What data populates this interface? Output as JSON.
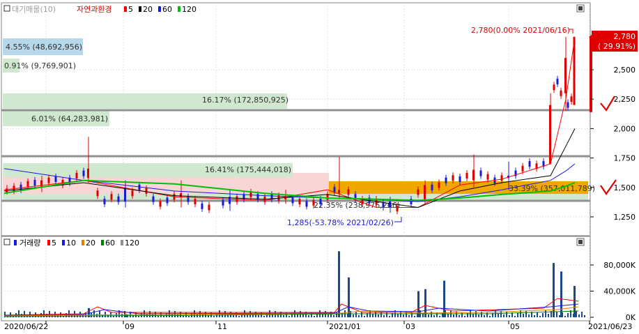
{
  "price_panel": {
    "legend": {
      "prefix_label": "대기매물(10)",
      "title": "자연과환경",
      "ma_items": [
        {
          "label": "5",
          "color": "#ff0000"
        },
        {
          "label": "20",
          "color": "#000000"
        },
        {
          "label": "60",
          "color": "#1a1adb"
        },
        {
          "label": "120",
          "color": "#00c000"
        }
      ]
    },
    "y_ticks": [
      "2,500",
      "2,250",
      "2,000",
      "1,750",
      "1,500",
      "1,250"
    ],
    "current_price": {
      "price": "2,780",
      "change": "( 29.91%)"
    },
    "high_annotation": "2,780(0.00% 2021/06/16)",
    "low_annotation": "1,285(-53.78% 2021/02/26)",
    "supply_zones": [
      {
        "label": "4.55% (48,692,956)",
        "pct": 4.55
      },
      {
        "label": "0.91% (9,769,901)",
        "pct": 0.91
      },
      {
        "label": "16.17% (172,850,925)",
        "pct": 16.17
      },
      {
        "label": "6.01% (64,283,981)",
        "pct": 6.01
      },
      {
        "label": "16.41% (175,444,018)",
        "pct": 16.41
      },
      {
        "label": "33.39% (357,011,789)",
        "pct": 33.39
      },
      {
        "label": "22.35% (238,976,266)",
        "pct": 22.35
      }
    ]
  },
  "volume_panel": {
    "legend": {
      "title": "거래량",
      "ma_items": [
        {
          "label": "5",
          "color": "#ff0000"
        },
        {
          "label": "10",
          "color": "#1a1adb"
        },
        {
          "label": "20",
          "color": "#e08000"
        },
        {
          "label": "60",
          "color": "#008000"
        },
        {
          "label": "120",
          "color": "#909090"
        }
      ]
    },
    "y_ticks": [
      "80,000K",
      "40,000K",
      "0K"
    ]
  },
  "x_axis_labels": [
    "2020/06/22",
    "09",
    "11",
    "2021/01",
    "03",
    "05",
    "2021/06/23"
  ],
  "colors": {
    "up": "#e00000",
    "down": "#1a1adb",
    "supply": "#7ec87e",
    "supply_max": "#f0a800",
    "accent_check": "#e00000"
  },
  "chart_data": [
    {
      "type": "candlestick",
      "title": "자연과환경",
      "x_range": [
        "2020/06/22",
        "2021/06/23"
      ],
      "ylim": [
        1150,
        2850
      ],
      "series": [
        {
          "name": "5",
          "x": [
            "2020/06",
            "2020/08",
            "2020/10",
            "2020/12",
            "2021/01",
            "2021/02",
            "2021/03",
            "2021/04",
            "2021/05",
            "2021/06/10",
            "2021/06/16",
            "2021/06/23"
          ],
          "values": [
            1480,
            1560,
            1420,
            1390,
            1480,
            1330,
            1330,
            1520,
            1570,
            1700,
            2250,
            2780
          ]
        },
        {
          "name": "20",
          "x": [
            "2020/06",
            "2020/08",
            "2020/10",
            "2020/12",
            "2021/01",
            "2021/02",
            "2021/03",
            "2021/04",
            "2021/05",
            "2021/06/10",
            "2021/06/16",
            "2021/06/23"
          ],
          "values": [
            1470,
            1540,
            1430,
            1400,
            1440,
            1380,
            1330,
            1470,
            1540,
            1600,
            1850,
            2000
          ]
        },
        {
          "name": "60",
          "x": [
            "2020/06",
            "2020/08",
            "2020/10",
            "2020/12",
            "2021/01",
            "2021/02",
            "2021/03",
            "2021/04",
            "2021/05",
            "2021/06/10",
            "2021/06/16",
            "2021/06/23"
          ],
          "values": [
            1660,
            1560,
            1470,
            1430,
            1410,
            1400,
            1380,
            1420,
            1480,
            1560,
            1640,
            1700
          ]
        },
        {
          "name": "120",
          "x": [
            "2020/06",
            "2020/08",
            "2020/10",
            "2020/12",
            "2021/01",
            "2021/02",
            "2021/03",
            "2021/04",
            "2021/05",
            "2021/06/10",
            "2021/06/16",
            "2021/06/23"
          ],
          "values": [
            1450,
            1560,
            1530,
            1450,
            1410,
            1400,
            1390,
            1410,
            1440,
            1470,
            1510,
            1540
          ]
        }
      ],
      "candles": [
        {
          "x": "2020/06/22",
          "open": 1460,
          "high": 1520,
          "low": 1440,
          "close": 1490
        },
        {
          "x": "2020/07",
          "open": 1500,
          "high": 1600,
          "low": 1460,
          "close": 1560
        },
        {
          "x": "2020/08",
          "open": 1580,
          "high": 1930,
          "low": 1540,
          "close": 1660
        },
        {
          "x": "2020/09",
          "open": 1500,
          "high": 1560,
          "low": 1330,
          "close": 1380
        },
        {
          "x": "2020/10",
          "open": 1420,
          "high": 1560,
          "low": 1330,
          "close": 1450
        },
        {
          "x": "2020/11",
          "open": 1420,
          "high": 1480,
          "low": 1300,
          "close": 1360
        },
        {
          "x": "2020/12",
          "open": 1400,
          "high": 1480,
          "low": 1360,
          "close": 1420
        },
        {
          "x": "2021/01",
          "open": 1450,
          "high": 1760,
          "low": 1400,
          "close": 1480
        },
        {
          "x": "2021/02",
          "open": 1380,
          "high": 1420,
          "low": 1285,
          "close": 1330
        },
        {
          "x": "2021/03",
          "open": 1400,
          "high": 1560,
          "low": 1360,
          "close": 1520
        },
        {
          "x": "2021/04",
          "open": 1560,
          "high": 1780,
          "low": 1500,
          "close": 1650
        },
        {
          "x": "2021/05",
          "open": 1600,
          "high": 1720,
          "low": 1480,
          "close": 1580
        },
        {
          "x": "2021/06/10",
          "open": 1700,
          "high": 2300,
          "low": 1700,
          "close": 2200
        },
        {
          "x": "2021/06/16",
          "open": 2300,
          "high": 2780,
          "low": 2150,
          "close": 2600
        },
        {
          "x": "2021/06/23",
          "open": 2140,
          "high": 2780,
          "low": 2140,
          "close": 2780
        }
      ],
      "ylabel": "",
      "xlabel": ""
    },
    {
      "type": "bar",
      "title": "거래량",
      "ylim": [
        0,
        100000
      ],
      "x": [
        "2020/08",
        "2020/09",
        "2021/01",
        "2021/01b",
        "2021/03",
        "2021/04",
        "2021/04b",
        "2021/06a",
        "2021/06b",
        "2021/06c"
      ],
      "values": [
        14000,
        5000,
        101000,
        61000,
        40000,
        43000,
        56000,
        83000,
        70000,
        48000
      ],
      "ylabel": "",
      "xlabel": ""
    }
  ]
}
